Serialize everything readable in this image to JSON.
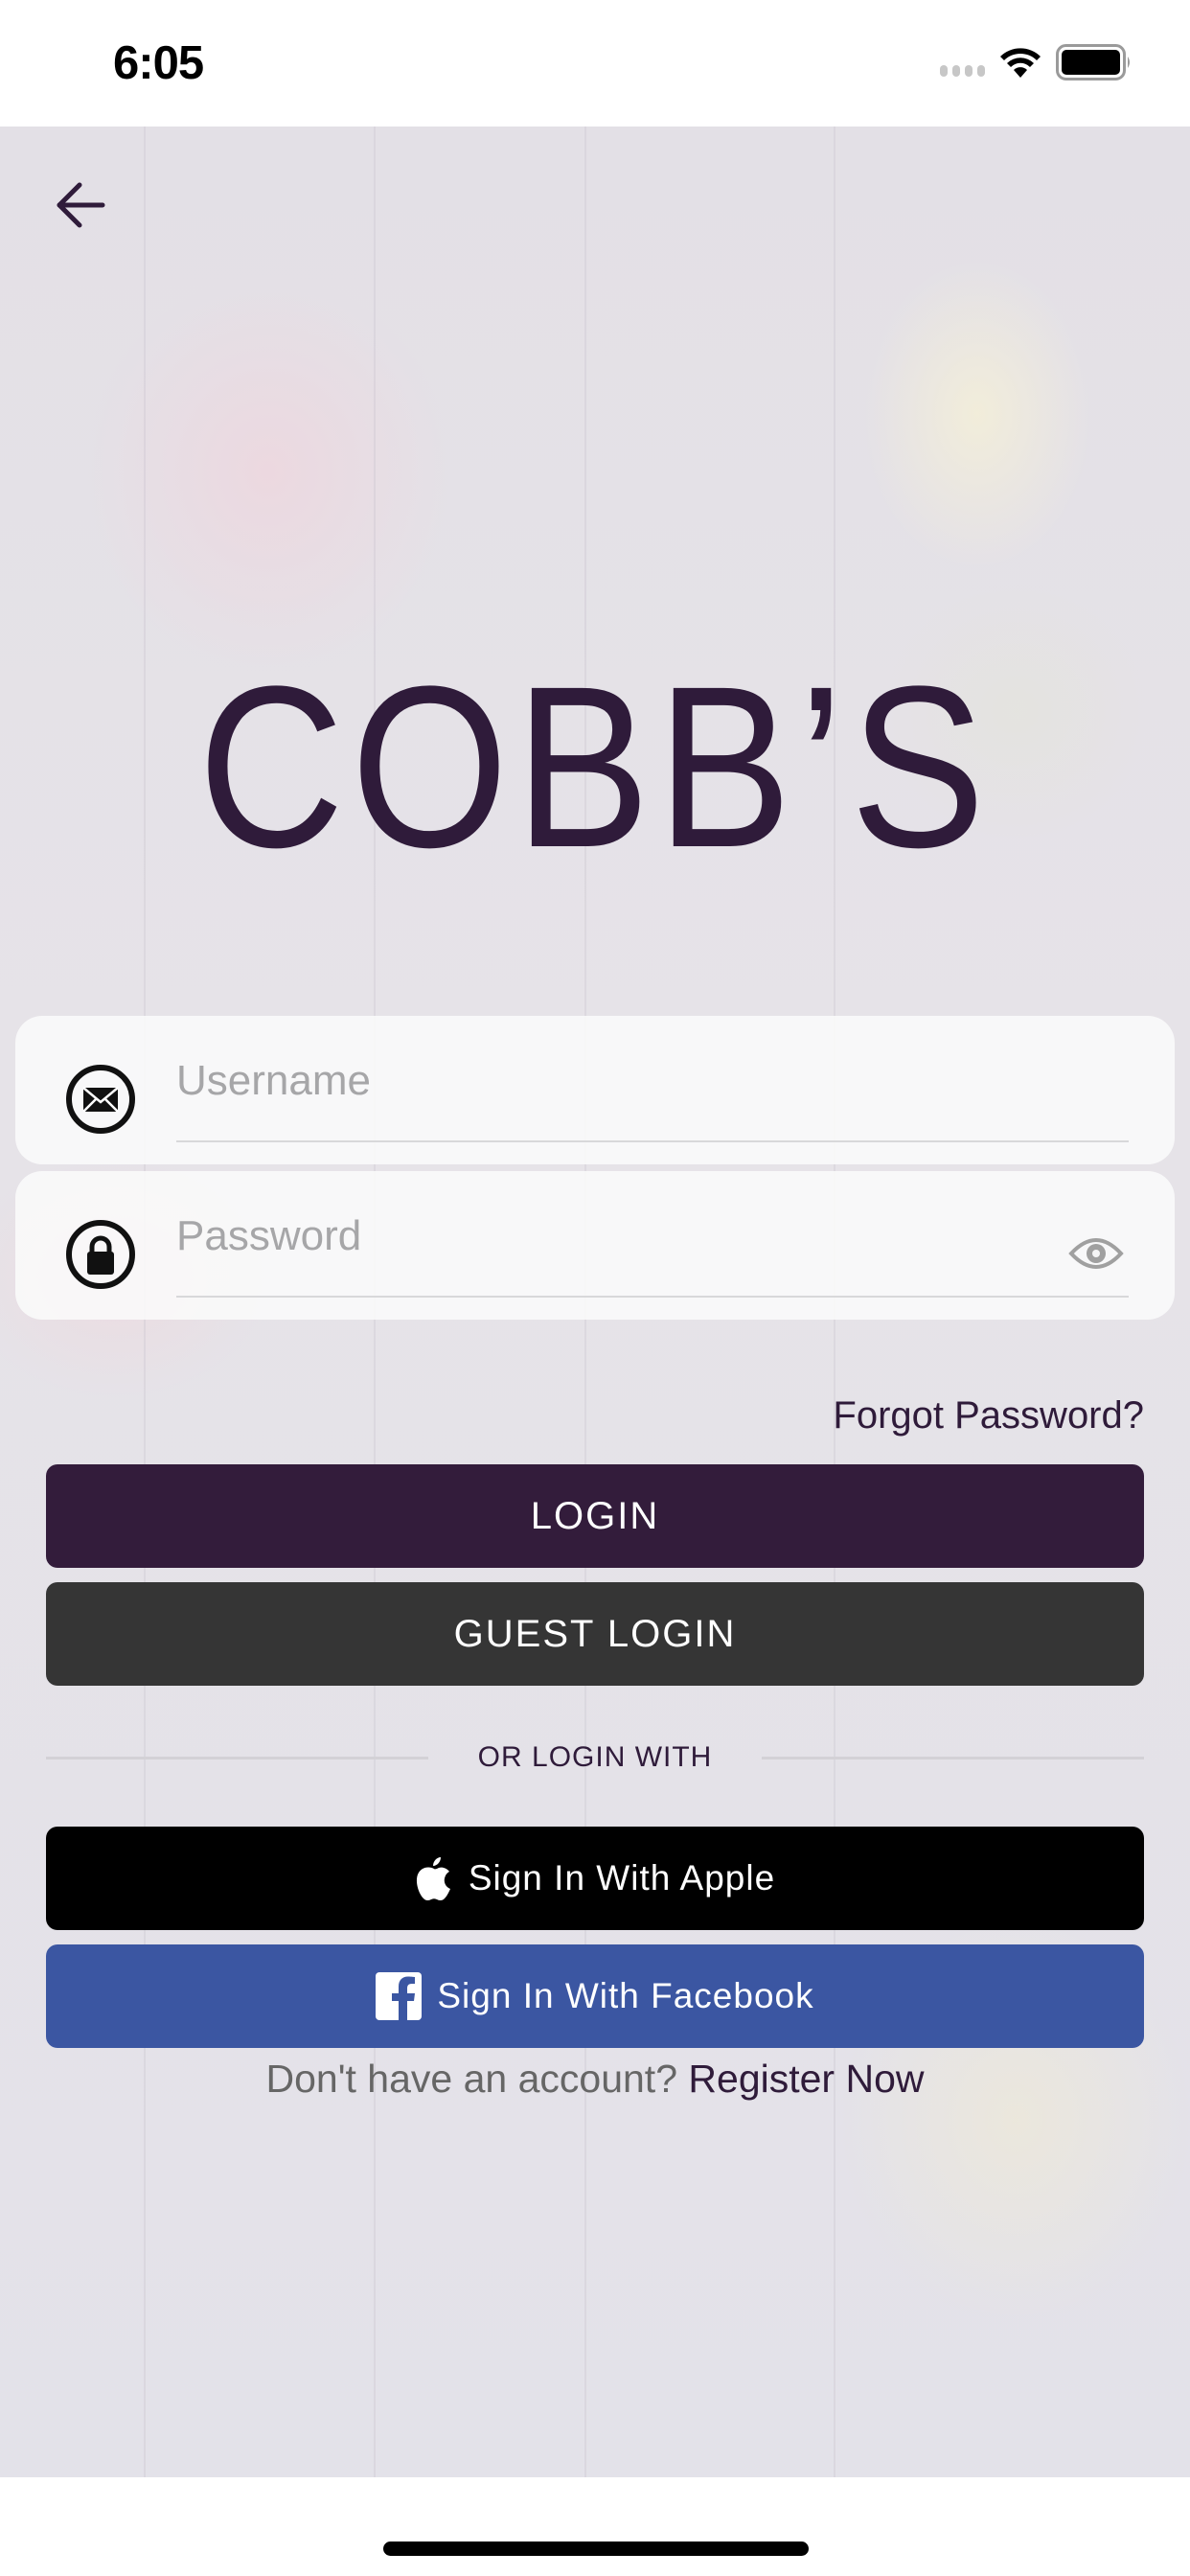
{
  "status_bar": {
    "time": "6:05",
    "icons": [
      "cellular-signal-icon",
      "wifi-icon",
      "battery-icon"
    ]
  },
  "header": {
    "back_icon": "arrow-left-icon"
  },
  "brand": {
    "logo_text": "COBB’S",
    "color": "#2f1b3a"
  },
  "form": {
    "username": {
      "icon": "envelope-icon",
      "placeholder": "Username",
      "value": ""
    },
    "password": {
      "icon": "lock-icon",
      "placeholder": "Password",
      "value": "",
      "toggle_icon": "eye-icon"
    },
    "forgot_password_label": "Forgot Password?"
  },
  "actions": {
    "login_label": "LOGIN",
    "guest_login_label": "GUEST LOGIN",
    "divider_label": "OR LOGIN WITH",
    "apple_label": "Sign In With Apple",
    "facebook_label": "Sign In With Facebook"
  },
  "register": {
    "prompt": "Don't have an account? ",
    "link_label": "Register Now"
  },
  "colors": {
    "primary": "#331c3b",
    "guest": "#353535",
    "apple": "#000000",
    "facebook": "#3b56a2",
    "text_dark": "#2f1b3a"
  }
}
